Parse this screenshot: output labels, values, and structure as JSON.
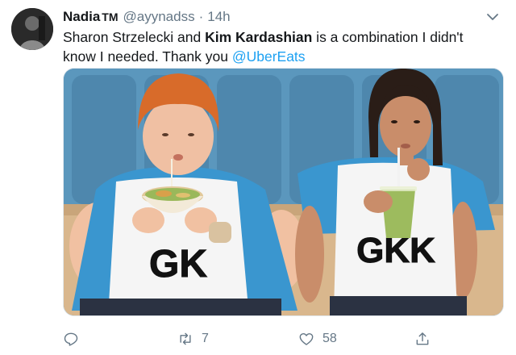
{
  "tweet": {
    "display_name": "Nadia",
    "display_name_suffix": "TM",
    "handle": "@ayynadss",
    "separator": "·",
    "time": "14h",
    "text_part1": "Sharon Strzelecki and ",
    "text_bold": "Kim Kardashian",
    "text_part2": " is a combination I didn't know I needed. Thank you ",
    "mention": "@UberEats",
    "media_logo_left": "GK",
    "media_logo_right": "GKK",
    "colors": {
      "mention": "#1da1f2",
      "muted": "#657786",
      "text": "#14171a"
    }
  },
  "actions": {
    "reply_icon": "reply-icon",
    "retweet_icon": "retweet-icon",
    "retweet_count": "7",
    "like_icon": "like-icon",
    "like_count": "58",
    "share_icon": "share-icon"
  }
}
